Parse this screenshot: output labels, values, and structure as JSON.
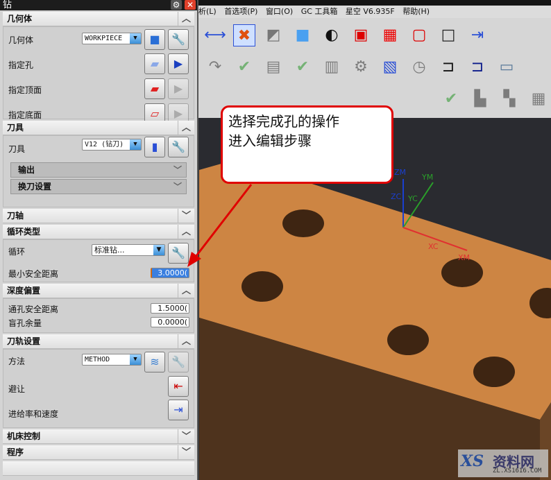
{
  "dialog": {
    "title": "钻",
    "settings_icon": "gear-icon",
    "close_icon": "close-icon",
    "geometry": {
      "header": "几何体",
      "geometry_label": "几何体",
      "geometry_value": "WORKPIECE",
      "specify_holes": "指定孔",
      "specify_top": "指定顶面",
      "specify_bottom": "指定底面"
    },
    "tool": {
      "header": "刀具",
      "tool_label": "刀具",
      "tool_value": "V12 (钻刀)",
      "output": "输出",
      "tool_change": "换刀设置"
    },
    "tool_axis": {
      "header": "刀轴"
    },
    "cycle": {
      "header": "循环类型",
      "cycle_label": "循环",
      "cycle_value": "标准钻...",
      "min_clearance_label": "最小安全距离",
      "min_clearance_value": "3.0000("
    },
    "depth": {
      "header": "深度偏置",
      "through_label": "通孔安全距离",
      "through_value": "1.5000(",
      "blind_label": "盲孔余量",
      "blind_value": "0.0000("
    },
    "path": {
      "header": "刀轨设置",
      "method_label": "方法",
      "method_value": "METHOD",
      "avoid_label": "避让",
      "feeds_label": "进给率和速度"
    },
    "machine": {
      "header": "机床控制"
    },
    "program": {
      "header": "程序"
    }
  },
  "menu": [
    "析(L)",
    "首选项(P)",
    "窗口(O)",
    "GC 工具箱",
    "星空 V6.935F",
    "帮助(H)"
  ],
  "callout": {
    "line1": "选择完成孔的操作",
    "line2": "进入编辑步骤"
  },
  "axes": {
    "zm": "ZM",
    "zc": "ZC",
    "yc": "YC",
    "ym": "YM",
    "xc": "XC",
    "xm": "XM"
  },
  "watermark": {
    "brand": "资料网",
    "url": "ZL.XS1616.COM",
    "logo": "XS"
  },
  "colors": {
    "part_top": "#cd8543",
    "part_side": "#4e331d",
    "background": "#2a2b30",
    "callout_border": "#e00000"
  }
}
